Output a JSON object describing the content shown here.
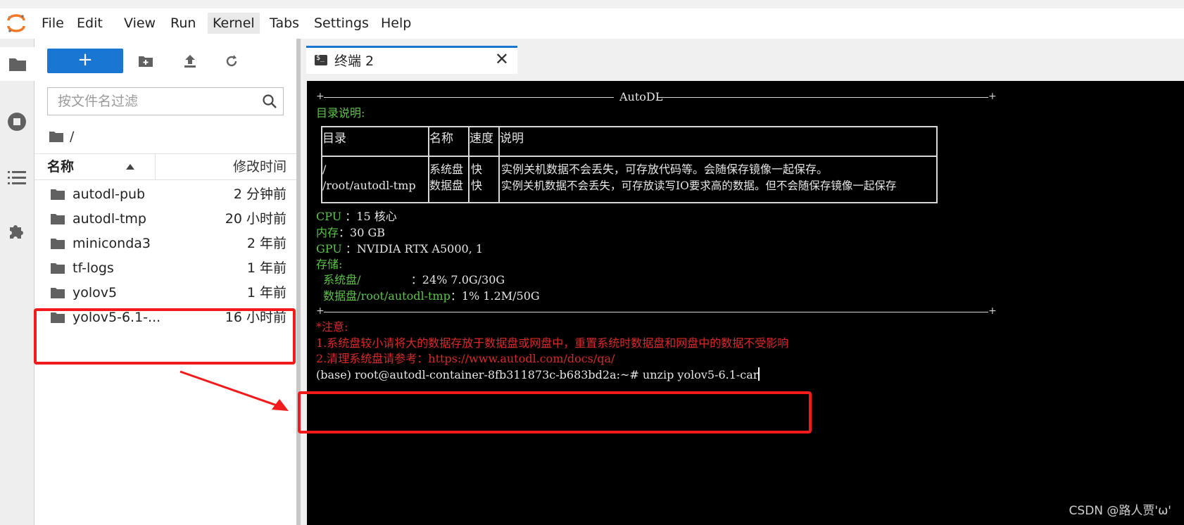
{
  "menubar": {
    "items": [
      "File",
      "Edit",
      "View",
      "Run",
      "Kernel",
      "Tabs",
      "Settings",
      "Help"
    ],
    "active": "Kernel"
  },
  "activitybar": {
    "icons": [
      "folder-icon",
      "stop-circle-icon",
      "list-icon",
      "puzzle-icon"
    ]
  },
  "filebrowser": {
    "new_label": "+",
    "filter_placeholder": "按文件名过滤",
    "breadcrumb": "/",
    "col_name": "名称",
    "col_modified": "修改时间",
    "files": [
      {
        "name": "autodl-pub",
        "modified": "2 分钟前"
      },
      {
        "name": "autodl-tmp",
        "modified": "20 小时前"
      },
      {
        "name": "miniconda3",
        "modified": "2 年前"
      },
      {
        "name": "tf-logs",
        "modified": "1 年前"
      },
      {
        "name": "yolov5",
        "modified": "1 年前"
      },
      {
        "name": "yolov5-6.1-...",
        "modified": "16 小时前"
      }
    ]
  },
  "tab": {
    "icon_glyph": "$_",
    "label": "终端 2",
    "close": "✕"
  },
  "terminal": {
    "banner_title": "AutoDL",
    "dir_heading": "目录说明:",
    "table_header": {
      "dir": "目录",
      "name": "名称",
      "speed": "速度",
      "desc": "说明"
    },
    "table_rows": [
      {
        "dir": "/",
        "name": "系统盘",
        "speed": "快",
        "desc": "实例关机数据不会丢失，可存放代码等。会随保存镜像一起保存。"
      },
      {
        "dir": "/root/autodl-tmp",
        "name": "数据盘",
        "speed": "快",
        "desc": "实例关机数据不会丢失，可存放读写IO要求高的数据。但不会随保存镜像一起保存"
      }
    ],
    "cpu_label": "CPU ",
    "cpu_value": "：15 核心",
    "mem_label": "内存",
    "mem_value": "：30 GB",
    "gpu_label": "GPU ",
    "gpu_value": "：NVIDIA RTX A5000, 1",
    "storage_label": "存储:",
    "sys_disk_label": "  系统盘/              ",
    "sys_disk_value": "：24% 7.0G/30G",
    "data_disk_label": "  数据盘/root/autodl-tmp",
    "data_disk_value": "：1% 1.2M/50G",
    "note_heading": "*注意:",
    "note_1": "1.系统盘较小请将大的数据存放于数据盘或网盘中，重置系统时数据盘和网盘中的数据不受影响",
    "note_2": "2.清理系统盘请参考：https://www.autodl.com/docs/qa/",
    "prompt": "(base) root@autodl-container-8fb311873c-b683bd2a:~# ",
    "command": "unzip yolov5-6.1-car"
  },
  "watermark": "CSDN @路人贾'ω'",
  "colors": {
    "accent": "#1976d2",
    "terminal_green": "#5ec24a",
    "terminal_red": "#d62b2b",
    "annotation_red": "#f21a1a"
  }
}
